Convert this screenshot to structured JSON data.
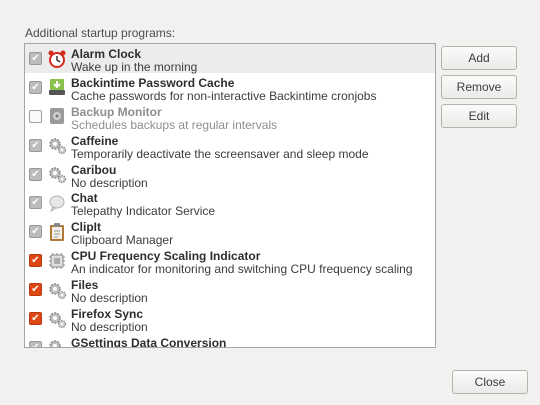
{
  "heading": "Additional startup programs:",
  "buttons": {
    "add": "Add",
    "remove": "Remove",
    "edit": "Edit",
    "close": "Close"
  },
  "colors": {
    "check_gray": "#bcbcbc",
    "check_orange": "#dd4814",
    "selected_row": "#ececec"
  },
  "programs": [
    {
      "name": "Alarm Clock",
      "desc": "Wake up in the morning",
      "checked": true,
      "icon": "alarm-clock-icon",
      "selected": true
    },
    {
      "name": "Backintime Password Cache",
      "desc": "Cache passwords for non-interactive Backintime cronjobs",
      "checked": true,
      "icon": "download-arrow-icon"
    },
    {
      "name": "Backup Monitor",
      "desc": "Schedules backups at regular intervals",
      "checked": false,
      "icon": "backup-monitor-icon",
      "disabled": true
    },
    {
      "name": "Caffeine",
      "desc": "Temporarily deactivate the screensaver and sleep mode",
      "checked": true,
      "icon": "gears-icon"
    },
    {
      "name": "Caribou",
      "desc": "No description",
      "checked": true,
      "icon": "gears-icon"
    },
    {
      "name": "Chat",
      "desc": "Telepathy Indicator Service",
      "checked": true,
      "icon": "chat-bubble-icon"
    },
    {
      "name": "ClipIt",
      "desc": "Clipboard Manager",
      "checked": true,
      "icon": "clipboard-icon"
    },
    {
      "name": "CPU Frequency Scaling Indicator",
      "desc": "An indicator for monitoring and switching CPU frequency scaling",
      "checked": true,
      "icon": "cpu-chip-icon",
      "accent": true
    },
    {
      "name": "Files",
      "desc": "No description",
      "checked": true,
      "icon": "gears-icon",
      "accent": true
    },
    {
      "name": "Firefox Sync",
      "desc": "No description",
      "checked": true,
      "icon": "gears-icon",
      "accent": true
    },
    {
      "name": "GSettings Data Conversion",
      "desc": "",
      "checked": true,
      "icon": "gears-icon"
    }
  ]
}
